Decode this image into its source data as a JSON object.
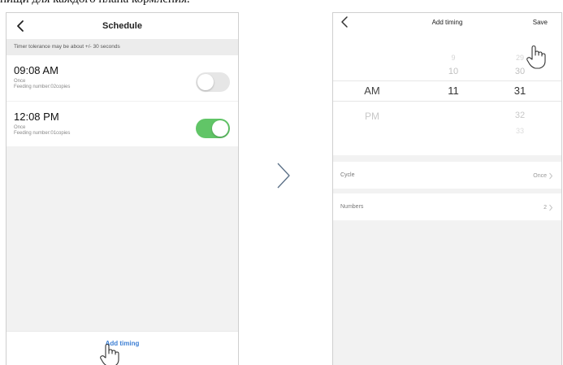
{
  "caption": "пищи для каждого плана кормления.",
  "schedule_screen": {
    "title": "Schedule",
    "tolerance_note": "Timer tolerance may be about +/- 30 seconds",
    "items": [
      {
        "time": "09:08 AM",
        "cycle": "Once",
        "feeding": "Feeding number:02copies",
        "enabled": false
      },
      {
        "time": "12:08 PM",
        "cycle": "Once",
        "feeding": "Feeding number:01copies",
        "enabled": true
      }
    ],
    "add_timing_label": "Add timing"
  },
  "add_timing_screen": {
    "title": "Add timing",
    "save_label": "Save",
    "picker": {
      "ampm": [
        "AM",
        "PM"
      ],
      "ampm_selected": "AM",
      "hours": [
        "9",
        "10",
        "11"
      ],
      "hour_selected": "11",
      "minutes": [
        "29",
        "30",
        "31",
        "32",
        "33"
      ],
      "minute_selected": "31"
    },
    "cycle_label": "Cycle",
    "cycle_value": "Once",
    "numbers_label": "Numbers",
    "numbers_value": "2"
  },
  "colors": {
    "toggle_on": "#61c567",
    "toggle_off": "#e6e6e6",
    "link_blue": "#3d7fd4"
  },
  "icons": [
    "chevron-left-icon",
    "chevron-right-icon",
    "hand-pointer-icon"
  ]
}
